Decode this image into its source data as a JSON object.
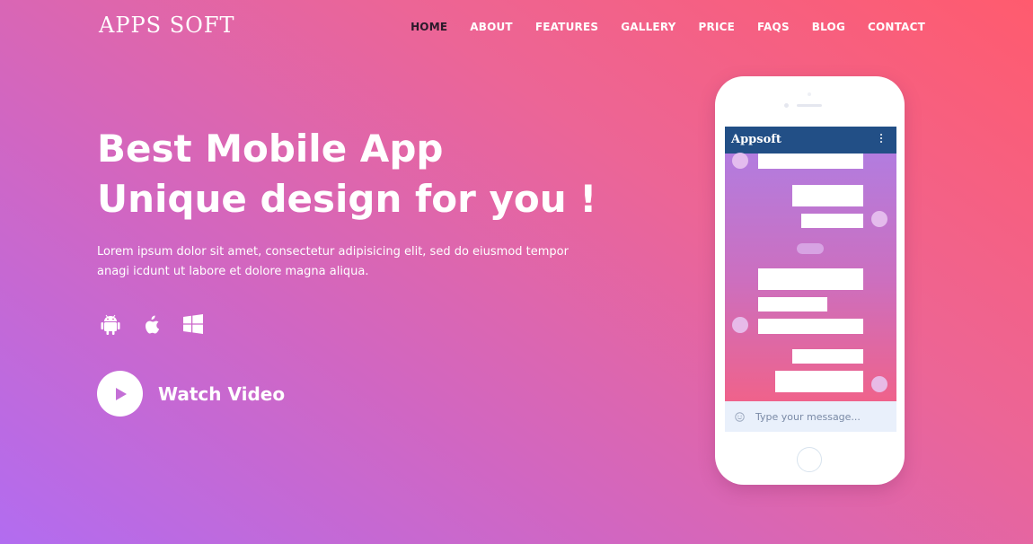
{
  "brand": "APPS SOFT",
  "nav": {
    "home": "HOME",
    "about": "ABOUT",
    "features": "FEATURES",
    "gallery": "GALLERY",
    "price": "PRICE",
    "faqs": "FAQS",
    "blog": "BLOG",
    "contact": "CONTACT",
    "active": "HOME"
  },
  "hero": {
    "title_line1": "Best Mobile App",
    "title_line2": "Unique design for you !",
    "description_line1": "Lorem ipsum dolor sit amet, consectetur adipisicing elit, sed do eiusmod tempor",
    "description_line2": "anagi icdunt ut labore et dolore magna aliqua.",
    "platforms": [
      "android-icon",
      "apple-icon",
      "windows-icon"
    ],
    "watch_video_label": "Watch Video"
  },
  "phone": {
    "app_title": "Appsoft",
    "message_placeholder": "Type your message..."
  },
  "colors": {
    "gradient_start": "#b26cf0",
    "gradient_end": "#ff5b6e",
    "active_nav": "#2a1a2a",
    "app_bar": "#224f86",
    "play_icon": "#c46fd6"
  }
}
